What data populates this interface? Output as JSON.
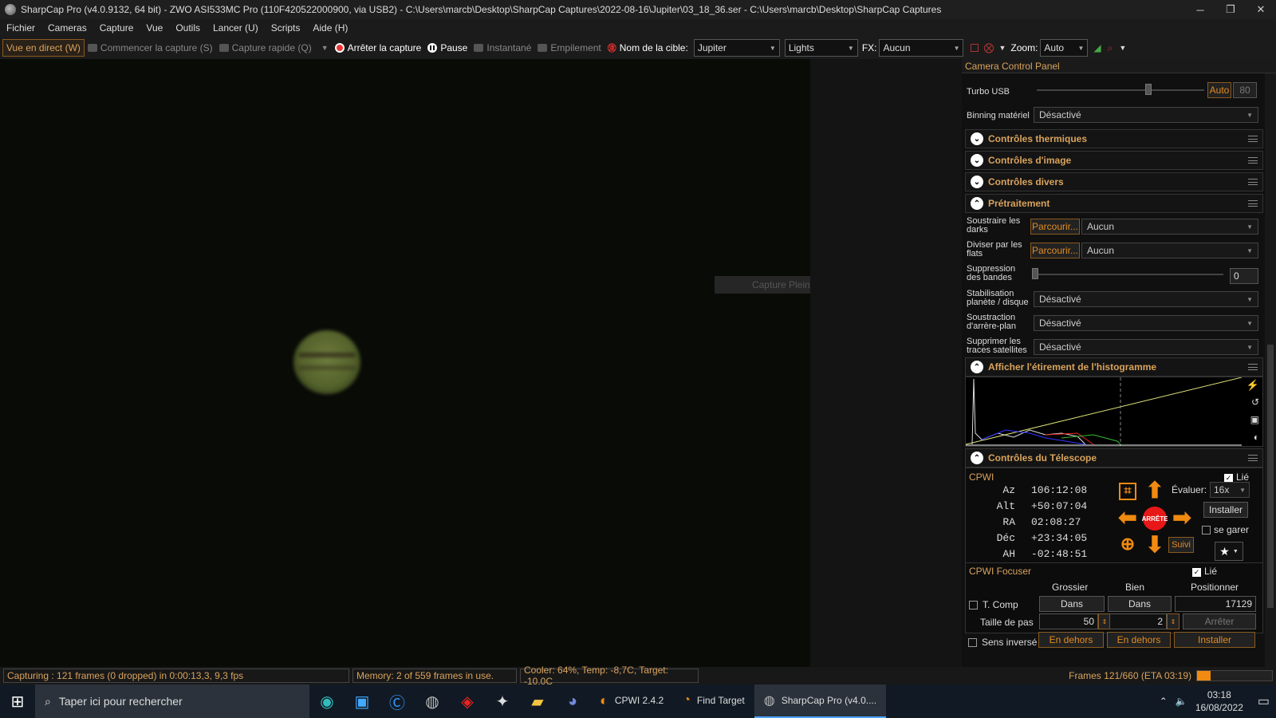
{
  "window": {
    "title": "SharpCap Pro (v4.0.9132, 64 bit) - ZWO ASI533MC Pro (110F420522000900, via USB2) - C:\\Users\\marcb\\Desktop\\SharpCap Captures\\2022-08-16\\Jupiter\\03_18_36.ser - C:\\Users\\marcb\\Desktop\\SharpCap Captures",
    "minimize": "─",
    "maximize": "❐",
    "close": "✕"
  },
  "menu": [
    "Fichier",
    "Cameras",
    "Capture",
    "Vue",
    "Outils",
    "Lancer (U)",
    "Scripts",
    "Aide (H)"
  ],
  "toolbar": {
    "live": "Vue en direct (W)",
    "start": "Commencer la capture (S)",
    "quick": "Capture rapide (Q)",
    "stop": "Arrêter la capture",
    "pause": "Pause",
    "snapshot": "Instantané",
    "stack": "Empilement",
    "target_label": "Nom de la cible:",
    "target_value": "Jupiter",
    "frametype": "Lights",
    "fx_label": "FX:",
    "fx_value": "Aucun",
    "zoom_label": "Zoom:",
    "zoom_value": "Auto"
  },
  "viewport": {
    "tooltip": "Capture Plein écran"
  },
  "panel": {
    "title": "Camera Control Panel",
    "turbo_label": "Turbo USB",
    "turbo_auto": "Auto",
    "turbo_value": "80",
    "binning_label": "Binning matériel",
    "binning_value": "Désactivé",
    "sections": [
      "Contrôles thermiques",
      "Contrôles d'image",
      "Contrôles divers",
      "Prétraitement"
    ],
    "darks_label1": "Soustraire les",
    "darks_label2": "darks",
    "flats_label1": "Diviser par les",
    "flats_label2": "flats",
    "browse": "Parcourir...",
    "none": "Aucun",
    "banding_label1": "Suppression",
    "banding_label2": "des bandes",
    "banding_value": "0",
    "stab_label1": "Stabilisation",
    "stab_label2": "planète / disque",
    "bg_label1": "Soustraction",
    "bg_label2": "d'arrère-plan",
    "sat_label1": "Supprimer les",
    "sat_label2": "traces satellites",
    "disabled": "Désactivé",
    "histo_title": "Afficher l'étirement de l'histogramme",
    "scope_title": "Contrôles du Télescope",
    "scope_name": "CPWI",
    "linked": "Lié",
    "coords": [
      {
        "k": "Az",
        "v": "106:12:08"
      },
      {
        "k": "Alt",
        "v": "+50:07:04"
      },
      {
        "k": "RA",
        "v": "02:08:27"
      },
      {
        "k": "Déc",
        "v": "+23:34:05"
      },
      {
        "k": "AH",
        "v": "-02:48:51"
      }
    ],
    "stop_btn": "ARRÊTE",
    "rate_label": "Évaluer:",
    "rate_value": "16x",
    "install": "Installer",
    "park": "se garer",
    "track": "Suivi",
    "focuser_name": "CPWI Focuser",
    "col_coarse": "Grossier",
    "col_fine": "Bien",
    "col_pos": "Positionner",
    "tcomp": "T. Comp",
    "in_btn": "Dans",
    "position": "17129",
    "step_label": "Taille de pas",
    "step_coarse": "50",
    "step_fine": "2",
    "stop_focus": "Arrêter",
    "reverse": "Sens inversé",
    "out_btn": "En dehors",
    "install2": "Installer"
  },
  "status": {
    "capturing": "Capturing : 121 frames (0 dropped) in 0:00:13,3, 9,3 fps",
    "memory": "Memory: 2 of 559 frames in use.",
    "cooler": "Cooler: 64%, Temp: -8,7C, Target: -10,0C",
    "frames": "Frames 121/660 (ETA 03:19)",
    "progress": 0.18
  },
  "taskbar": {
    "search": "Taper ici pour rechercher",
    "apps": [
      "CPWI 2.4.2",
      "Find Target",
      "SharpCap Pro (v4.0...."
    ],
    "time": "03:18",
    "date": "16/08/2022"
  }
}
